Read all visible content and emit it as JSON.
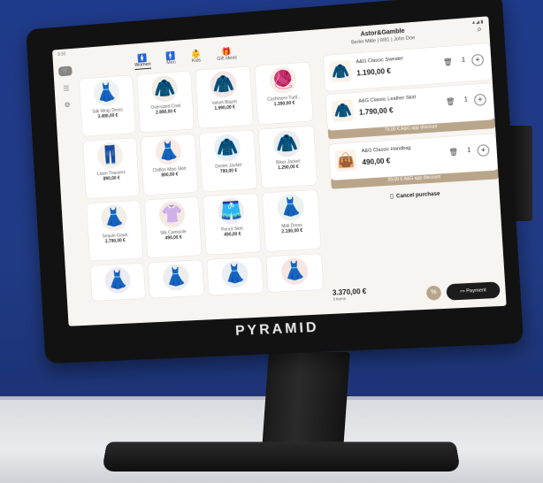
{
  "device": {
    "brand": "PYRAMID"
  },
  "status": {
    "time": "9:30",
    "signal": "▲◢ ▮"
  },
  "categories": [
    {
      "label": "Women",
      "icon": "woman-icon",
      "glyph": "🚺"
    },
    {
      "label": "Men",
      "icon": "man-icon",
      "glyph": "🚹"
    },
    {
      "label": "Kids",
      "icon": "kids-icon",
      "glyph": "👶"
    },
    {
      "label": "Gift ideas",
      "icon": "gift-icon",
      "glyph": "🎁"
    }
  ],
  "store": {
    "name": "Astor&Gamble",
    "location": "Berlin Mitte  |  0/81  |  John Doe"
  },
  "products": [
    {
      "name": "Silk Wrap Dress",
      "price": "3.490,00 €",
      "glyph": "👗",
      "bg": "#eef2f3"
    },
    {
      "name": "Oversized Coat",
      "price": "2.890,00 €",
      "glyph": "🧥",
      "bg": "#f3ece4"
    },
    {
      "name": "Velvet Blazer",
      "price": "1.990,00 €",
      "glyph": "🧥",
      "bg": "#f2e6e6"
    },
    {
      "name": "Cashmere Turtl...",
      "price": "1.390,00 €",
      "glyph": "🧶",
      "bg": "#f5efe6"
    },
    {
      "name": "Linen Trousers",
      "price": "890,00 €",
      "glyph": "👖",
      "bg": "#f6efe8"
    },
    {
      "name": "Chiffon Maxi Skirt",
      "price": "890,00 €",
      "glyph": "👗",
      "bg": "#f8ebe6"
    },
    {
      "name": "Denim Jacket",
      "price": "790,00 €",
      "glyph": "🧥",
      "bg": "#e8eef5"
    },
    {
      "name": "Biker Jacket",
      "price": "1.290,00 €",
      "glyph": "🧥",
      "bg": "#ececec"
    },
    {
      "name": "Sequin Gown",
      "price": "2.790,00 €",
      "glyph": "👗",
      "bg": "#f2ede7"
    },
    {
      "name": "Silk Camisole",
      "price": "490,00 €",
      "glyph": "👚",
      "bg": "#f5e9e4"
    },
    {
      "name": "Pencil Skirt",
      "price": "490,00 €",
      "glyph": "🩳",
      "bg": "#eeeeee"
    },
    {
      "name": "Midi Dress",
      "price": "2.190,00 €",
      "glyph": "👗",
      "bg": "#eaf2ee"
    },
    {
      "name": "",
      "price": "",
      "glyph": "👗",
      "bg": "#eeeaf3"
    },
    {
      "name": "",
      "price": "",
      "glyph": "👗",
      "bg": "#ededed"
    },
    {
      "name": "",
      "price": "",
      "glyph": "👗",
      "bg": "#e9eef3"
    },
    {
      "name": "",
      "price": "",
      "glyph": "👗",
      "bg": "#f7e5e2"
    }
  ],
  "order": {
    "lines": [
      {
        "name": "A&G Classic Sweater",
        "price": "1.190,00 €",
        "qty": "1",
        "glyph": "🧥",
        "discount": ""
      },
      {
        "name": "A&G Classic Leather Skirt",
        "price": "1.790,00 €",
        "qty": "1",
        "glyph": "🧥",
        "discount": "79,00 € A&G app discount"
      },
      {
        "name": "A&G Classic Handbag",
        "price": "490,00 €",
        "qty": "1",
        "glyph": "👜",
        "discount": "39,00 € A&G app discount"
      }
    ],
    "cancel_label": "Cancel purchase",
    "total": "3.370,00 €",
    "items_count": "3 items",
    "percent_label": "%",
    "payment_label": "Payment"
  }
}
